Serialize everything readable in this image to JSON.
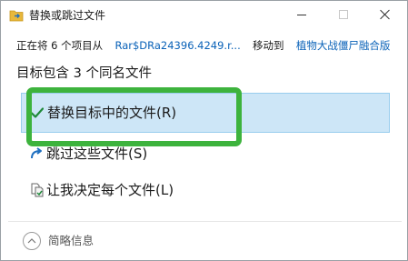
{
  "window": {
    "title": "替换或跳过文件"
  },
  "progress": {
    "prefix": "正在将 6 个项目从",
    "source": "Rar$DRa24396.4249.r...",
    "middle": "移动到",
    "destination": "植物大战僵尸融合版"
  },
  "heading": "目标包含 3 个同名文件",
  "options": {
    "replace": "替换目标中的文件(R)",
    "skip": "跳过这些文件(S)",
    "decide": "让我决定每个文件(L)"
  },
  "footer": {
    "details_label": "简略信息"
  },
  "colors": {
    "selection_bg": "#cde6f7",
    "link": "#0a62b8",
    "highlight_outline": "#3db33d",
    "check": "#1f8a3a"
  },
  "icons": {
    "title": "file-move-icon",
    "replace": "checkmark-icon",
    "skip": "skip-arrow-icon",
    "decide": "compare-files-icon",
    "collapse": "chevron-up-icon"
  }
}
